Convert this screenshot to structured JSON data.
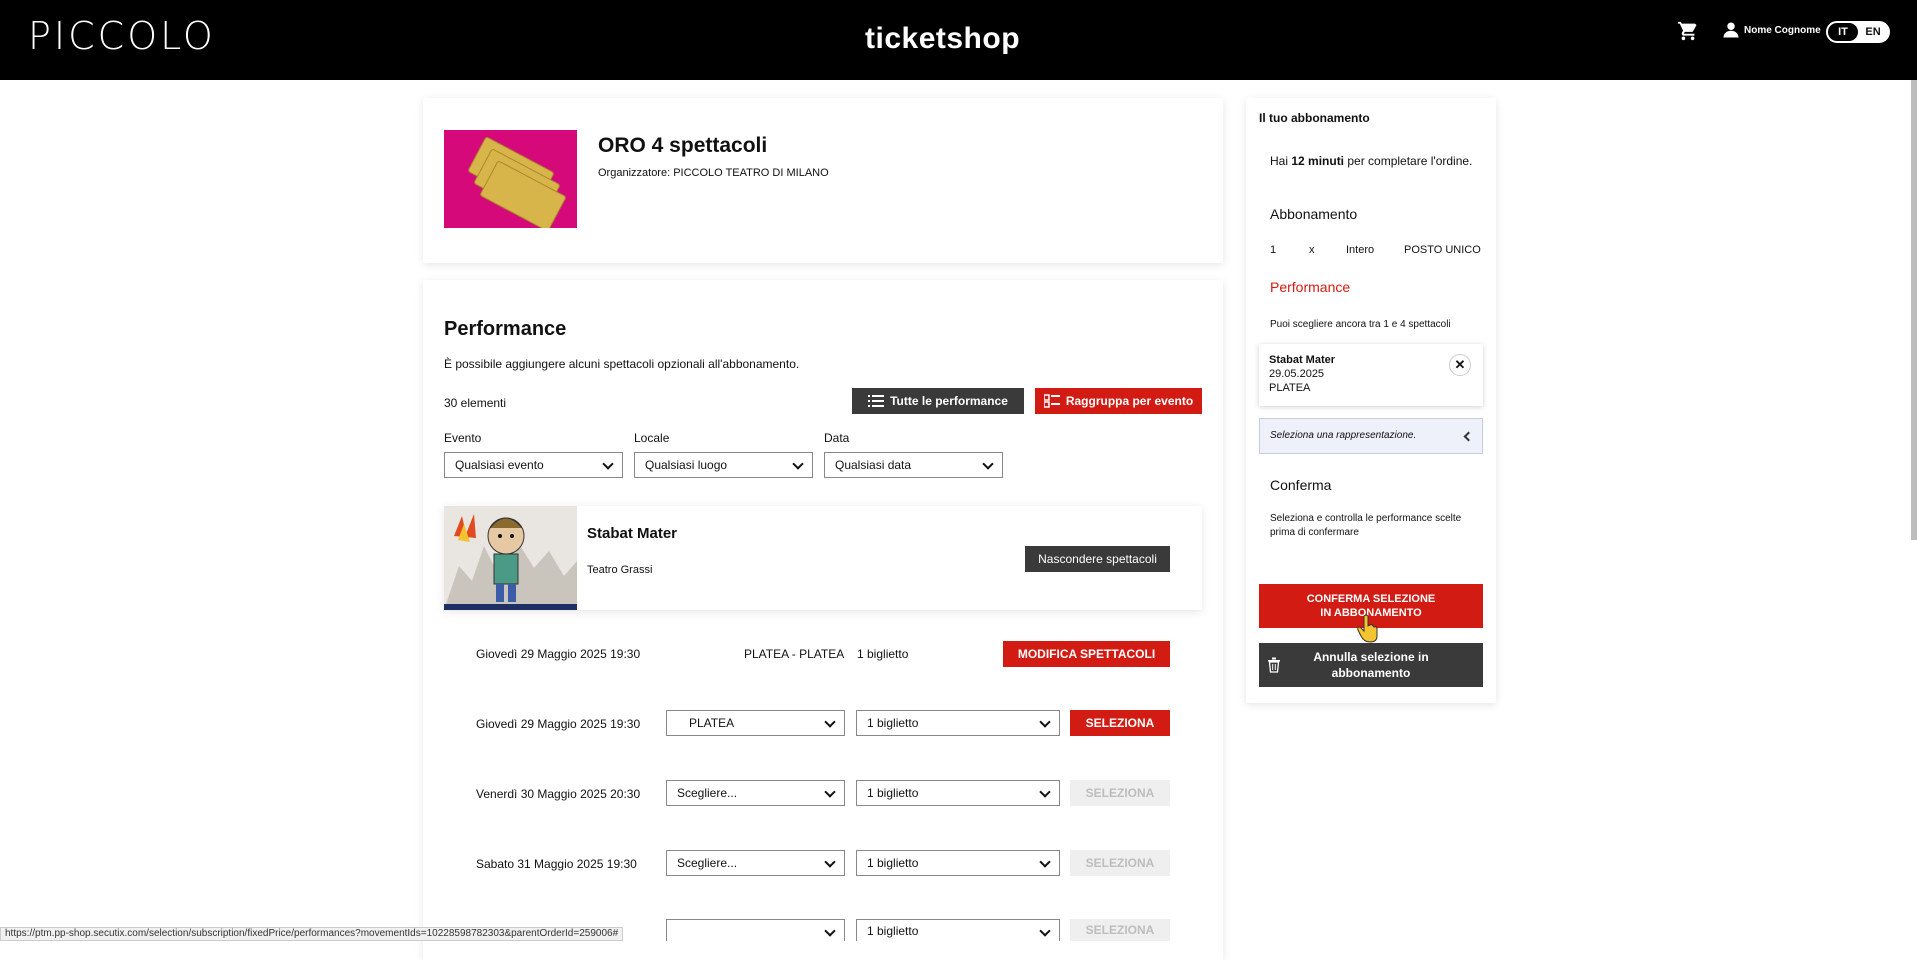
{
  "header": {
    "logo": "PICCOLO",
    "brand": "ticketshop",
    "user_name": "Nome Cognome",
    "lang_it": "IT",
    "lang_en": "EN"
  },
  "event": {
    "title": "ORO 4 spettacoli",
    "organizer": "Organizzatore: PICCOLO TEATRO DI MILANO"
  },
  "performances": {
    "title": "Performance",
    "description": "È possibile aggiungere alcuni spettacoli opzionali all'abbonamento.",
    "count": "30 elementi",
    "all_button": "Tutte le performance",
    "group_button": "Raggruppa per evento",
    "filters": {
      "event_label": "Evento",
      "event_value": "Qualsiasi evento",
      "venue_label": "Locale",
      "venue_value": "Qualsiasi luogo",
      "date_label": "Data",
      "date_value": "Qualsiasi data"
    },
    "show": {
      "title": "Stabat Mater",
      "venue": "Teatro Grassi",
      "hide_button": "Nascondere spettacoli"
    },
    "selected_row": {
      "date": "Giovedì 29 Maggio 2025 19:30",
      "sector": "PLATEA - PLATEA",
      "tickets": "1 biglietto",
      "button": "MODIFICA SPETTACOLI"
    },
    "rows": [
      {
        "date": "Giovedì 29 Maggio 2025 19:30",
        "sector": "PLATEA",
        "tickets": "1 biglietto",
        "button": "SELEZIONA"
      },
      {
        "date": "Venerdì 30 Maggio 2025 20:30",
        "sector": "Scegliere...",
        "tickets": "1 biglietto",
        "button": "SELEZIONA"
      },
      {
        "date": "Sabato 31 Maggio 2025 19:30",
        "sector": "Scegliere...",
        "tickets": "1 biglietto",
        "button": "SELEZIONA"
      },
      {
        "date": "",
        "sector": "",
        "tickets": "1 biglietto",
        "button": "SELEZIONA"
      }
    ]
  },
  "sidebar": {
    "title": "Il tuo abbonamento",
    "timer_pre": "Hai ",
    "timer_bold": "12 minuti",
    "timer_post": " per completare l'ordine.",
    "subscription_label": "Abbonamento",
    "qty": "1",
    "x": "x",
    "price_type": "Intero",
    "seat": "POSTO UNICO",
    "performance_label": "Performance",
    "performance_hint": "Puoi scegliere ancora tra 1 e 4 spettacoli",
    "selection": {
      "title": "Stabat Mater",
      "date": "29.05.2025",
      "sector": "PLATEA"
    },
    "select_rep": "Seleziona una rappresentazione.",
    "confirm_label": "Conferma",
    "confirm_hint": "Seleziona e controlla le performance scelte prima di confermare",
    "confirm_button_line1": "CONFERMA SELEZIONE",
    "confirm_button_line2": "IN ABBONAMENTO",
    "cancel_button_line1": "Annulla selezione in",
    "cancel_button_line2": "abbonamento"
  },
  "status_url": "https://ptm.pp-shop.secutix.com/selection/subscription/fixedPrice/performances?movementIds=10228598782303&parentOrderId=259006#",
  "colors": {
    "accent_red": "#d21b12",
    "dark": "#3a3a3a",
    "magenta": "#d6097a"
  }
}
